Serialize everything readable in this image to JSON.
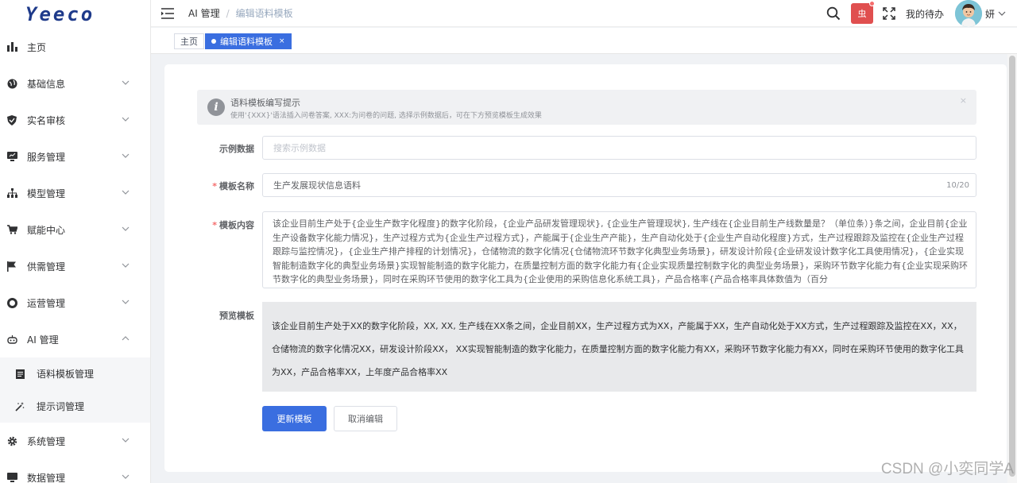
{
  "logo": {
    "text": "Yeeco"
  },
  "sidebar": {
    "items": [
      {
        "label": "主页",
        "icon": "bar-chart-icon",
        "chevron": ""
      },
      {
        "label": "基础信息",
        "icon": "globe-icon",
        "chevron": "down"
      },
      {
        "label": "实名审核",
        "icon": "shield-icon",
        "chevron": "down"
      },
      {
        "label": "服务管理",
        "icon": "monitor-icon",
        "chevron": "down"
      },
      {
        "label": "模型管理",
        "icon": "hierarchy-icon",
        "chevron": "down"
      },
      {
        "label": "赋能中心",
        "icon": "cart-icon",
        "chevron": "down"
      },
      {
        "label": "供需管理",
        "icon": "flag-icon",
        "chevron": "down"
      },
      {
        "label": "运营管理",
        "icon": "lifebuoy-icon",
        "chevron": "down"
      },
      {
        "label": "AI 管理",
        "icon": "robot-icon",
        "chevron": "up"
      }
    ],
    "subitems": [
      {
        "label": "语料模板管理",
        "icon": "document-icon"
      },
      {
        "label": "提示词管理",
        "icon": "magic-wand-icon"
      }
    ],
    "bottom_items": [
      {
        "label": "系统管理",
        "icon": "gear-icon"
      },
      {
        "label": "数据管理",
        "icon": "monitor-icon"
      }
    ]
  },
  "breadcrumb": {
    "parent": "AI 管理",
    "separator": "/",
    "current": "编辑语料模板"
  },
  "topbar": {
    "bug_label": "虫",
    "todo": "我的待办",
    "username": "妍"
  },
  "tags": [
    {
      "label": "主页",
      "active": false
    },
    {
      "label": "编辑语料模板",
      "active": true,
      "close": "×"
    }
  ],
  "alert": {
    "title": "语料模板编写提示",
    "desc": "使用'{XXX}'语法插入问卷答案, XXX:为问卷的问题, 选择示例数据后，可在下方预览模板生成效果",
    "close": "×"
  },
  "form": {
    "example_label": "示例数据",
    "example_placeholder": "搜索示例数据",
    "name_label": "模板名称",
    "name_value": "生产发展现状信息语料",
    "name_count": "10/20",
    "content_label": "模板内容",
    "content_value": "该企业目前生产处于{企业生产数字化程度}的数字化阶段，{企业产品研发管理现状}, {企业生产管理现状}, 生产线在{企业目前生产线数量是？（单位条）}条之间，企业目前{企业生产设备数字化能力情况}，生产过程方式为{企业生产过程方式}，产能属于{企业生产产能}，生产自动化处于{企业生产自动化程度}方式，生产过程跟踪及监控在{企业生产过程跟踪与监控情况}，{企业生产排产排程的计划情况}，仓储物流的数字化情况{仓储物流环节数字化典型业务场景}，研发设计阶段{企业研发设计数字化工具使用情况}，{企业实现智能制造数字化的典型业务场景}实现智能制造的数字化能力，在质量控制方面的数字化能力有{企业实现质量控制数字化的典型业务场景}，采购环节数字化能力有{企业实现采购环节数字化的典型业务场景}，同时在采购环节使用的数字化工具为{企业使用的采购信息化系统工具}，产品合格率{产品合格率具体数值为（百分",
    "required_mark": "*",
    "preview_label": "预览模板",
    "preview_value": "该企业目前生产处于XX的数字化阶段，XX, XX, 生产线在XX条之间，企业目前XX，生产过程方式为XX，产能属于XX，生产自动化处于XX方式，生产过程跟踪及监控在XX，XX，仓储物流的数字化情况XX，研发设计阶段XX， XX实现智能制造的数字化能力，在质量控制方面的数字化能力有XX，采购环节数字化能力有XX，同时在采购环节使用的数字化工具为XX，产品合格率XX，上年度产品合格率XX"
  },
  "buttons": {
    "update": "更新模板",
    "cancel": "取消编辑"
  },
  "watermark": "CSDN @小奕同学A",
  "colors": {
    "primary": "#3a6ee0",
    "danger": "#e04f4f",
    "required": "#f56c6c"
  }
}
